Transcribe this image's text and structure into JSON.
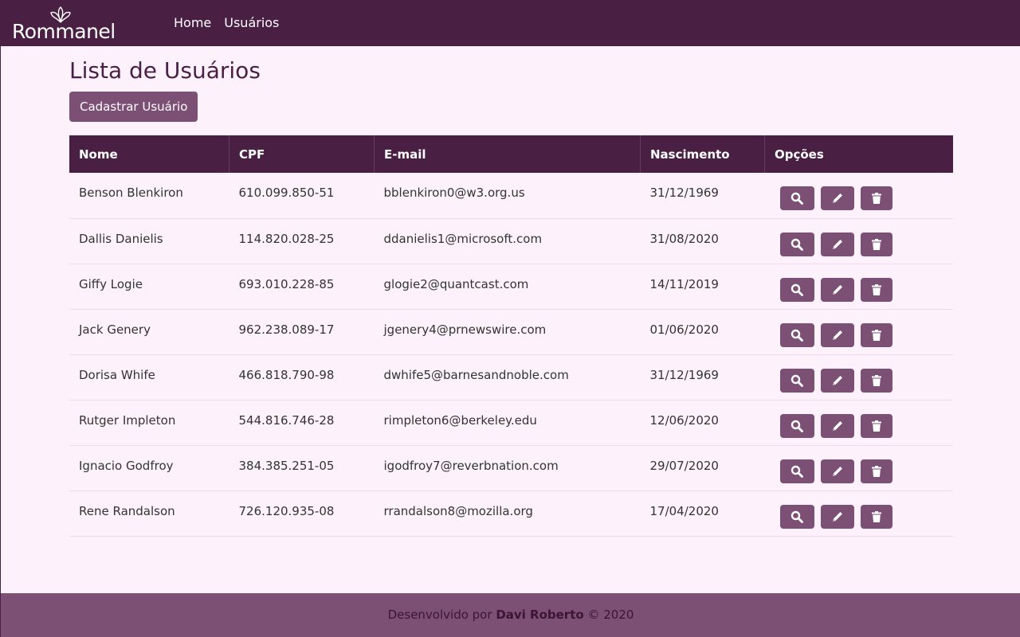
{
  "navbar": {
    "brand": "Rommanel",
    "links": [
      "Home",
      "Usuários"
    ]
  },
  "page": {
    "title": "Lista de Usuários",
    "create_button": "Cadastrar Usuário"
  },
  "table": {
    "headers": [
      "Nome",
      "CPF",
      "E-mail",
      "Nascimento",
      "Opções"
    ],
    "rows": [
      {
        "nome": "Benson Blenkiron",
        "cpf": "610.099.850-51",
        "email": "bblenkiron0@w3.org.us",
        "nascimento": "31/12/1969"
      },
      {
        "nome": "Dallis Danielis",
        "cpf": "114.820.028-25",
        "email": "ddanielis1@microsoft.com",
        "nascimento": "31/08/2020"
      },
      {
        "nome": "Giffy Logie",
        "cpf": "693.010.228-85",
        "email": "glogie2@quantcast.com",
        "nascimento": "14/11/2019"
      },
      {
        "nome": "Jack Genery",
        "cpf": "962.238.089-17",
        "email": "jgenery4@prnewswire.com",
        "nascimento": "01/06/2020"
      },
      {
        "nome": "Dorisa Whife",
        "cpf": "466.818.790-98",
        "email": "dwhife5@barnesandnoble.com",
        "nascimento": "31/12/1969"
      },
      {
        "nome": "Rutger Impleton",
        "cpf": "544.816.746-28",
        "email": "rimpleton6@berkeley.edu",
        "nascimento": "12/06/2020"
      },
      {
        "nome": "Ignacio Godfroy",
        "cpf": "384.385.251-05",
        "email": "igodfroy7@reverbnation.com",
        "nascimento": "29/07/2020"
      },
      {
        "nome": "Rene Randalson",
        "cpf": "726.120.935-08",
        "email": "rrandalson8@mozilla.org",
        "nascimento": "17/04/2020"
      }
    ],
    "action_icons": [
      "search-icon",
      "pencil-icon",
      "trash-icon"
    ]
  },
  "footer": {
    "prefix": "Desenvolvido por",
    "author": "Davi Roberto",
    "suffix": "© 2020"
  },
  "colors": {
    "navbar": "#4a1f44",
    "accent": "#7c4f74",
    "background": "#fdf2fc"
  }
}
